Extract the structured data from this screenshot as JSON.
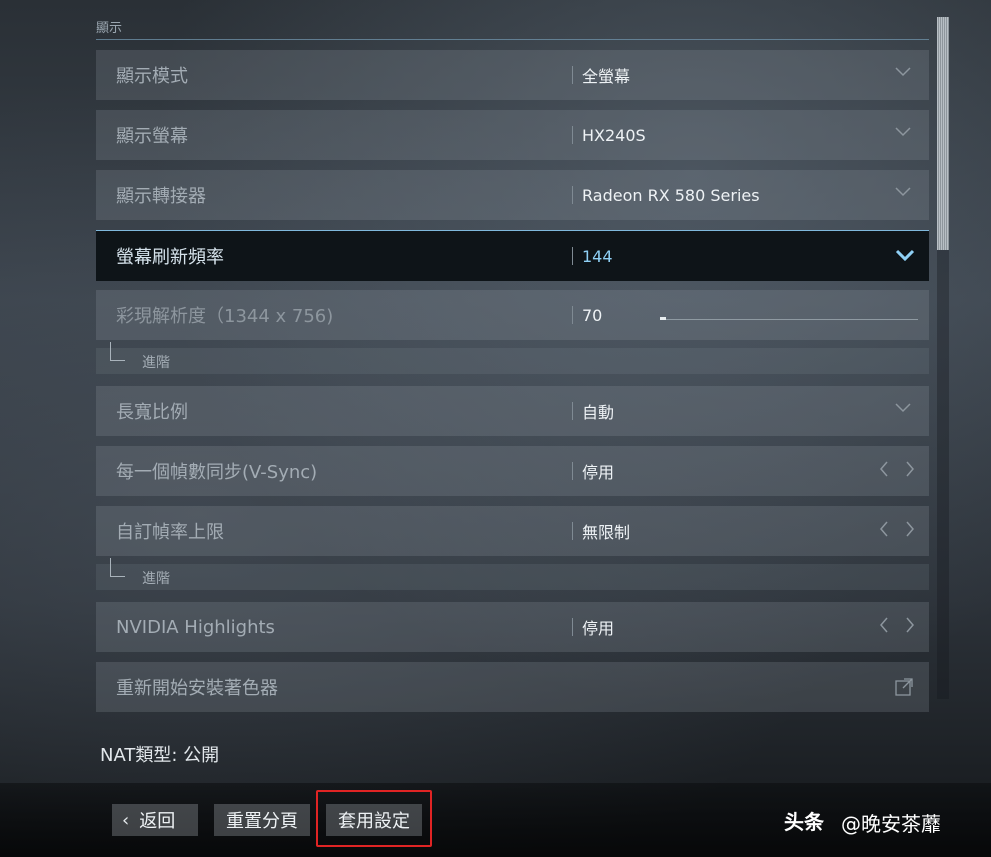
{
  "section": {
    "title": "顯示"
  },
  "rows": [
    {
      "label": "顯示模式",
      "value": "全螢幕",
      "control": "chevron-down-icon"
    },
    {
      "label": "顯示螢幕",
      "value": "HX240S",
      "control": "chevron-down-icon"
    },
    {
      "label": "顯示轉接器",
      "value": "Radeon RX 580 Series",
      "control": "chevron-down-icon"
    },
    {
      "label": "螢幕刷新頻率",
      "value": "144",
      "control": "chevron-down-icon",
      "active": true
    },
    {
      "label": "彩現解析度（1344 x 756)",
      "value": "70",
      "control": "slider",
      "slider_level": 0.01
    },
    {
      "label": "長寬比例",
      "value": "自動",
      "control": "chevron-down-icon"
    },
    {
      "label": "每一個幀數同步(V-Sync)",
      "value": "停用",
      "control": "arrows"
    },
    {
      "label": "自訂幀率上限",
      "value": "無限制",
      "control": "arrows"
    },
    {
      "label": "NVIDIA Highlights",
      "value": "停用",
      "control": "arrows"
    },
    {
      "label": "重新開始安裝著色器",
      "value": "",
      "control": "external-link-icon"
    }
  ],
  "sub_rows": [
    {
      "label": "進階"
    },
    {
      "label": "進階"
    }
  ],
  "nat": {
    "text": "NAT類型:  公開"
  },
  "buttons": {
    "back_label": "返回",
    "reset_label": "重置分頁",
    "apply_label": "套用設定"
  },
  "watermark": {
    "bold": "头条",
    "handle": "@晚安茶蘼"
  },
  "colors": {
    "accent": "#8fd0f5",
    "highlight_box": "#e02424"
  }
}
